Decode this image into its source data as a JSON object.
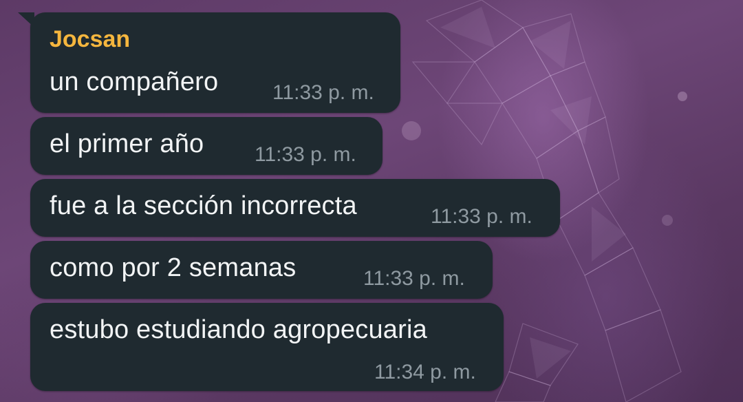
{
  "chat": {
    "sender_name": "Jocsan",
    "messages": [
      {
        "text": "un compañero",
        "time": "11:33 p. m."
      },
      {
        "text": "el primer año",
        "time": "11:33 p. m."
      },
      {
        "text": "fue a la sección incorrecta",
        "time": "11:33 p. m."
      },
      {
        "text": "como por 2 semanas",
        "time": "11:33 p. m."
      },
      {
        "text": "estubo estudiando agropecuaria",
        "time": "11:34 p. m."
      }
    ]
  },
  "colors": {
    "bubble": "#1f2a30",
    "sender_name": "#f5b63e",
    "timestamp": "#8f9aa1",
    "message_text": "#f2f4f5"
  }
}
